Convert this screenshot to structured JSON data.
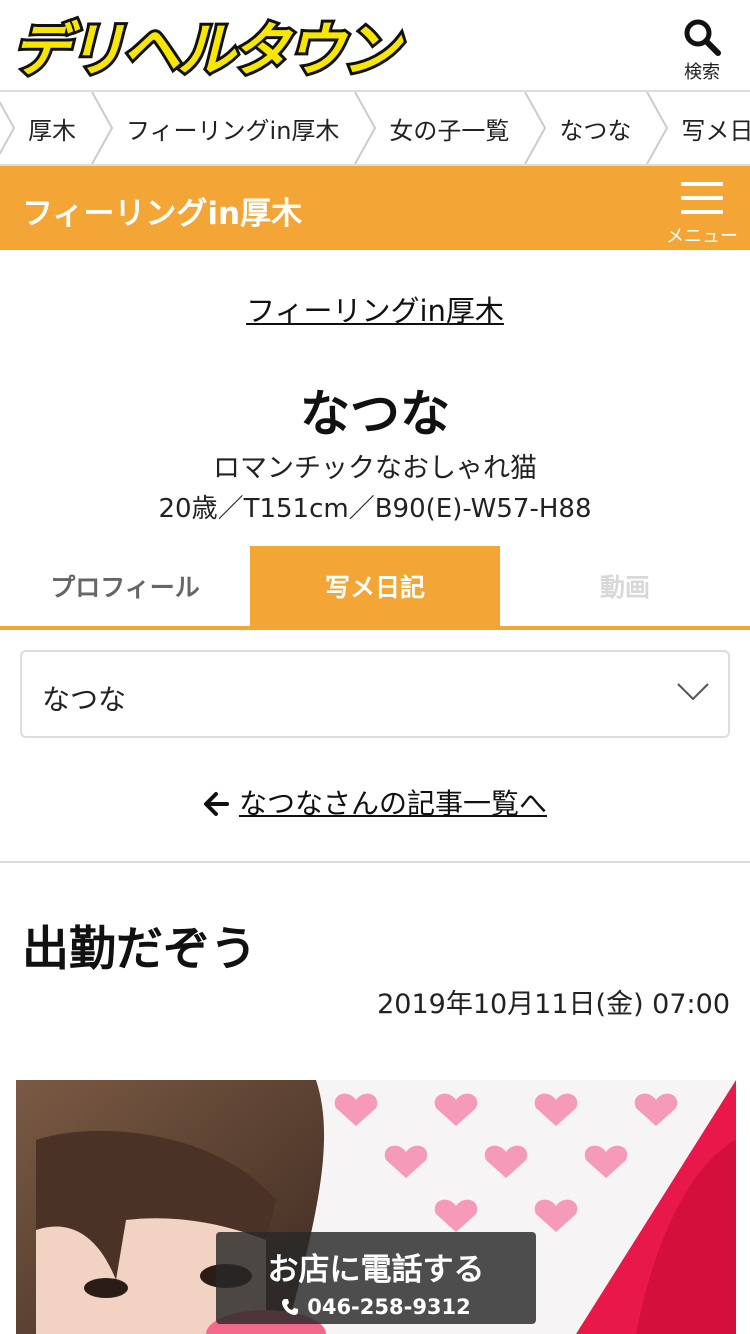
{
  "header": {
    "logo_text": "デリヘルタウン",
    "search_label": "検索"
  },
  "breadcrumb": [
    "厚木",
    "フィーリングin厚木",
    "女の子一覧",
    "なつな",
    "写メ日記"
  ],
  "shopbar": {
    "title": "フィーリングin厚木",
    "menu_label": "メニュー"
  },
  "profile": {
    "shop_link": "フィーリングin厚木",
    "name": "なつな",
    "catch": "ロマンチックなおしゃれ猫",
    "spec": "20歳／T151cm／B90(E)-W57-H88"
  },
  "tabs": {
    "profile": "プロフィール",
    "diary": "写メ日記",
    "movie": "動画"
  },
  "select": {
    "value": "なつな"
  },
  "back_link": "なつなさんの記事一覧へ",
  "article": {
    "title": "出勤だぞう",
    "date": "2019年10月11日(金) 07:00"
  },
  "call": {
    "label": "お店に電話する",
    "number": "046-258-9312"
  },
  "colors": {
    "accent": "#f3a535",
    "logo_yellow": "#f6e600"
  }
}
